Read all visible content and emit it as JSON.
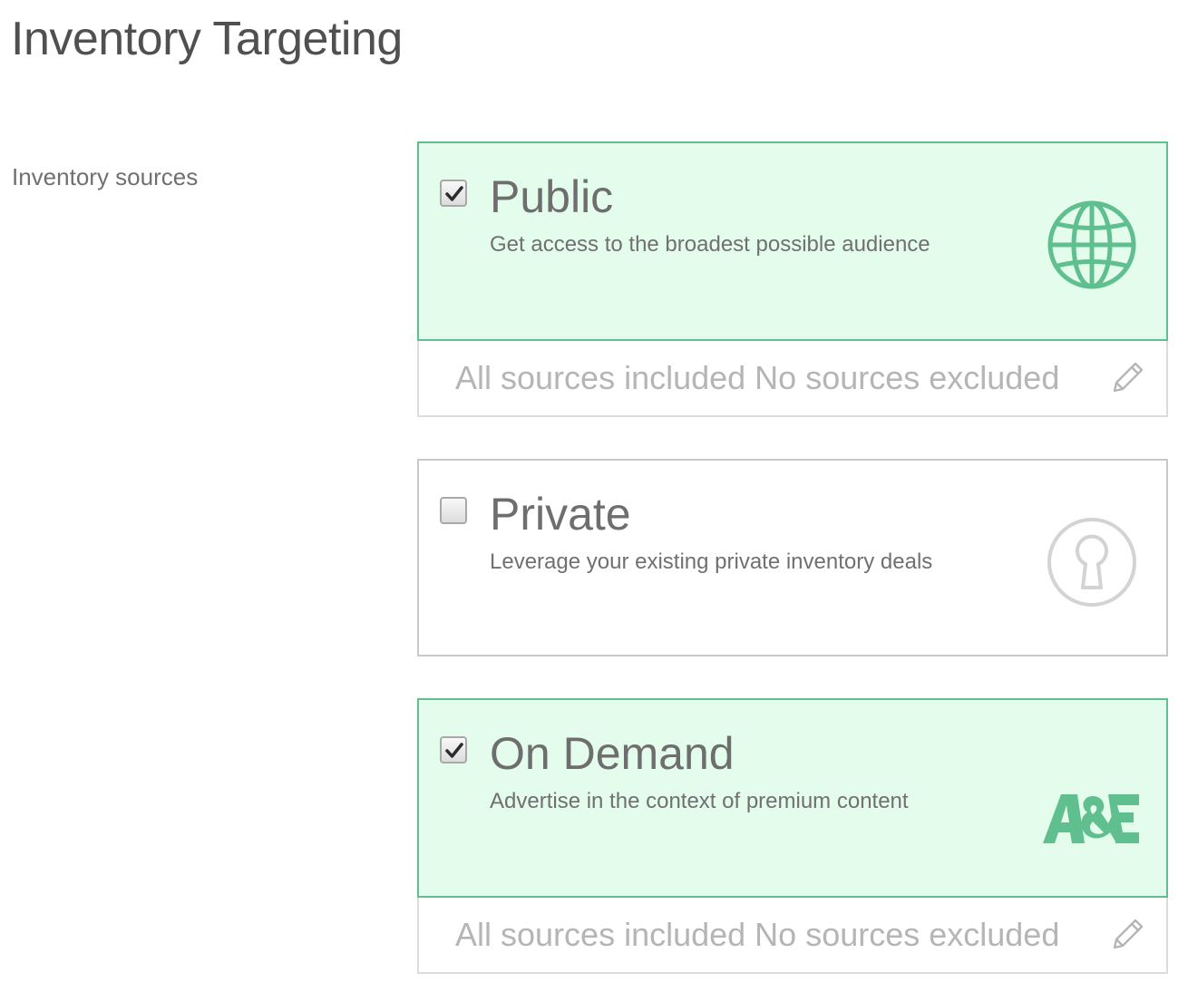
{
  "page": {
    "title": "Inventory Targeting"
  },
  "section": {
    "label": "Inventory sources"
  },
  "colors": {
    "accent": "#5fbf8f",
    "selected_bg": "#e3fcec",
    "muted": "#b5b5b5"
  },
  "sources": [
    {
      "title": "Public",
      "description": "Get access to the broadest possible audience",
      "checked": true,
      "icon": "globe-icon"
    },
    {
      "title": "Private",
      "description": "Leverage your existing private inventory deals",
      "checked": false,
      "icon": "keyhole-icon"
    },
    {
      "title": "On Demand",
      "description": "Advertise in the context of premium content",
      "checked": true,
      "icon": "ae-logo"
    }
  ],
  "summaries": [
    {
      "text": "All sources included No sources excluded",
      "icon": "pencil-icon"
    },
    {
      "text": "All sources included No sources excluded",
      "icon": "pencil-icon"
    }
  ]
}
